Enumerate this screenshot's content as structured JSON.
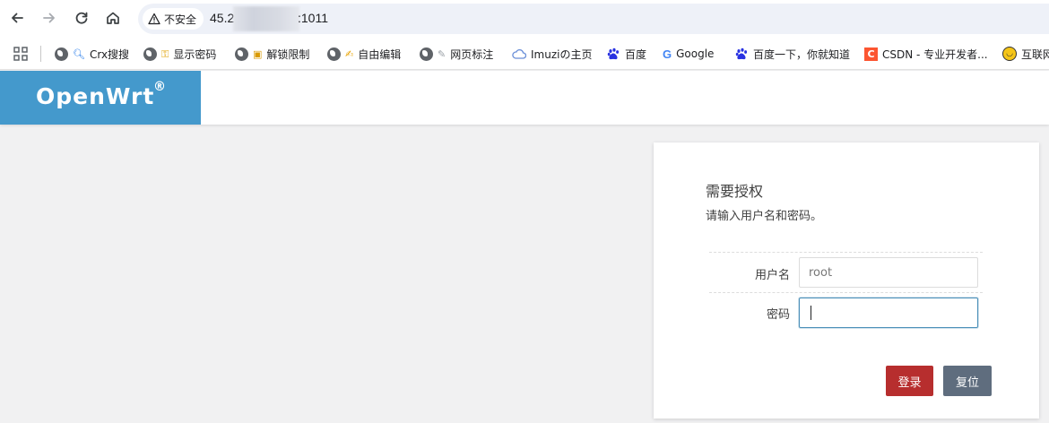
{
  "browser": {
    "security_label": "不安全",
    "url_prefix": "45.2",
    "url_suffix": ":1011"
  },
  "bookmarks": [
    {
      "label": "Crx搜搜",
      "icon": "globe-icon"
    },
    {
      "label": "显示密码",
      "icon": "globe-icon"
    },
    {
      "label": "解锁限制",
      "icon": "globe-icon"
    },
    {
      "label": "自由编辑",
      "icon": "globe-icon"
    },
    {
      "label": "网页标注",
      "icon": "globe-icon"
    },
    {
      "label": "Imuziの主页",
      "icon": "cloud-icon"
    },
    {
      "label": "百度",
      "icon": "baidu-paw-icon"
    },
    {
      "label": "Google",
      "icon": "google-icon"
    },
    {
      "label": "百度一下，你就知道",
      "icon": "baidu-paw-icon"
    },
    {
      "label": "CSDN - 专业开发者...",
      "icon": "csdn-icon"
    },
    {
      "label": "互联网",
      "icon": "smiley-icon"
    }
  ],
  "header": {
    "brand": "OpenWrt",
    "brand_mark": "®",
    "brand_color": "#4499cc"
  },
  "login": {
    "title": "需要授权",
    "description": "请输入用户名和密码。",
    "username_label": "用户名",
    "username_value": "root",
    "password_label": "密码",
    "password_value": "",
    "login_button": "登录",
    "reset_button": "复位",
    "login_color": "#b72e2e",
    "reset_color": "#5f6d7e"
  }
}
